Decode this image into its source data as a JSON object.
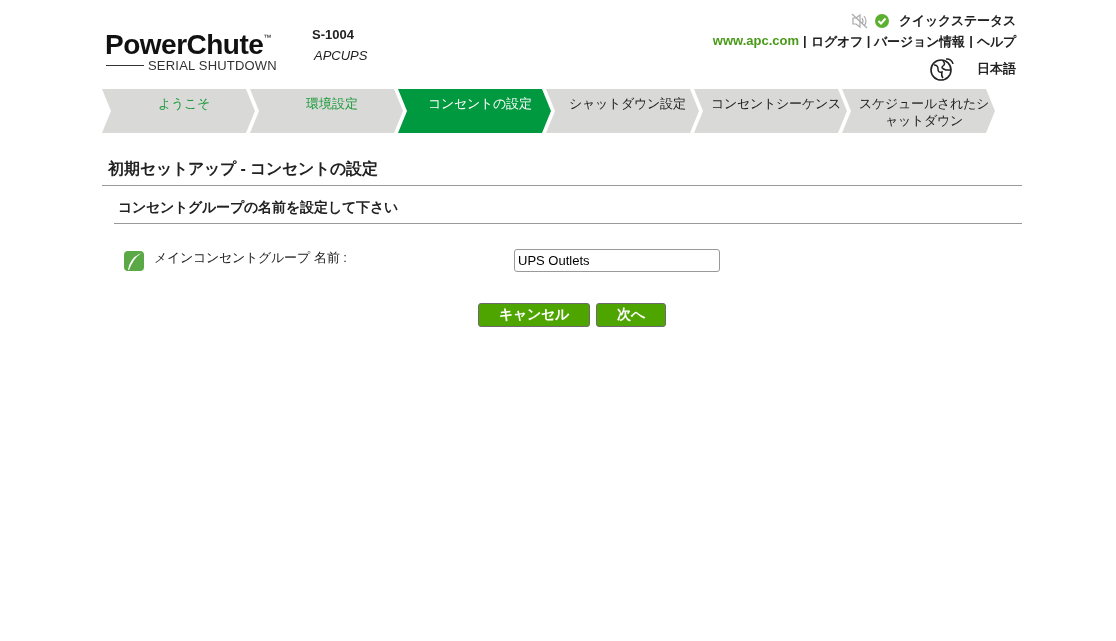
{
  "logo": {
    "name": "PowerChute$^{™}$",
    "subtitle": "SERIAL SHUTDOWN"
  },
  "device": {
    "model": "S-1004",
    "name": "APCUPS"
  },
  "quick_status": {
    "muted": true,
    "ok": true,
    "label": "クイックステータス"
  },
  "links": [
    {
      "label": "www.apc.com",
      "kind": "external"
    },
    {
      "label": "ログオフ",
      "kind": "nav"
    },
    {
      "label": "バージョン情報",
      "kind": "nav"
    },
    {
      "label": "ヘルプ",
      "kind": "nav"
    }
  ],
  "link_separator": "|",
  "language": "日本語",
  "steps": [
    {
      "label": "ようこそ",
      "kind": "done"
    },
    {
      "label": "環境設定",
      "kind": "done"
    },
    {
      "label": "コンセントの設定",
      "kind": "current"
    },
    {
      "label": "シャットダウン設定",
      "kind": "pending"
    },
    {
      "label": "コンセントシーケンス",
      "kind": "pending"
    },
    {
      "label": "スケジュールされたシャットダウン",
      "kind": "pending"
    }
  ],
  "page_title": "初期セットアップ - コンセントの設定",
  "section_title": "コンセントグループの名前を設定して下さい",
  "field": {
    "label": "メインコンセントグループ 名前 :",
    "value": "UPS Outlets"
  },
  "buttons": [
    "キャンセル",
    "次へ"
  ]
}
